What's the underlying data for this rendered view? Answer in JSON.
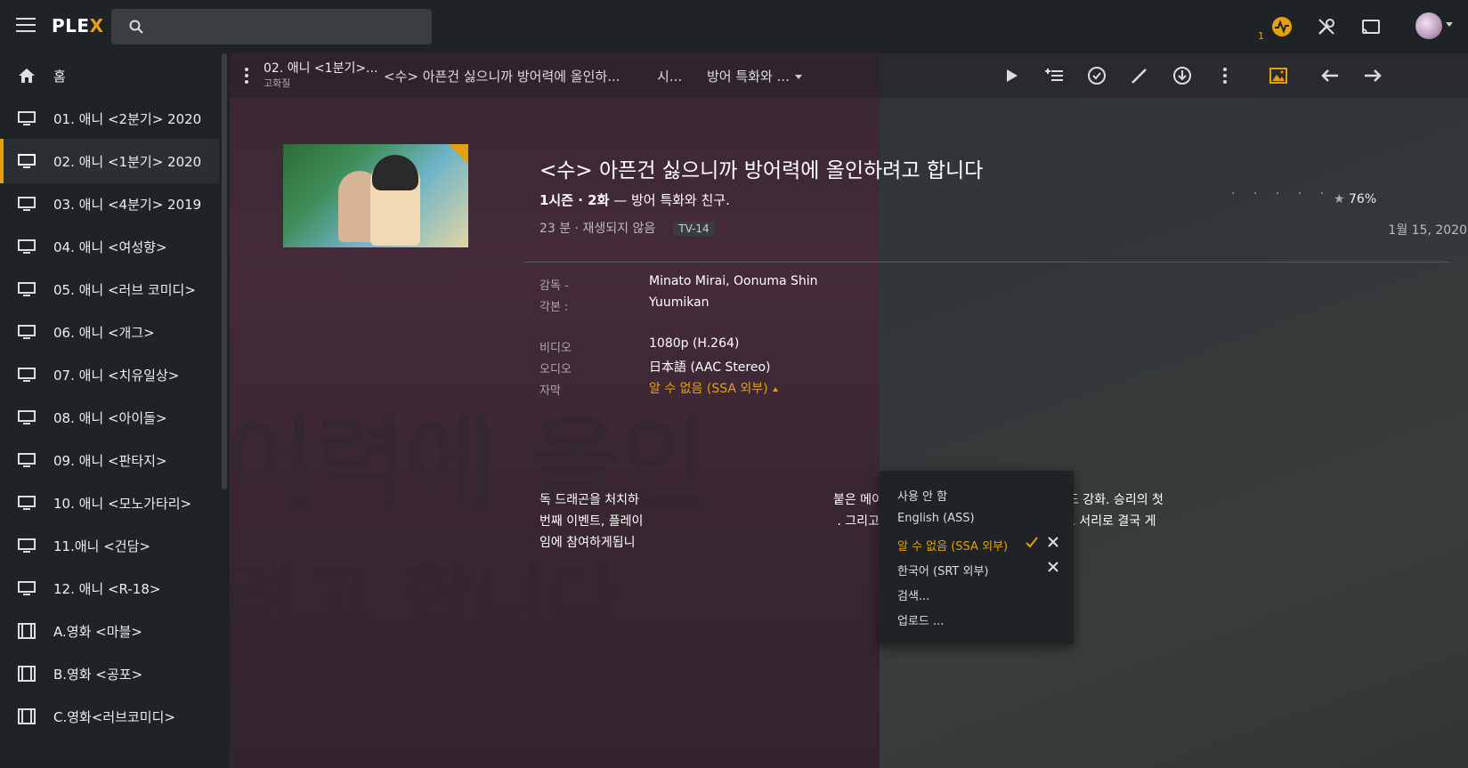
{
  "app": {
    "logo_text": "PLE",
    "logo_x": "X"
  },
  "topbar": {
    "activity_count": "1",
    "accent": "#e5a00d"
  },
  "sidebar": {
    "items": [
      {
        "label": "홈",
        "icon": "home-icon"
      },
      {
        "label": "01. 애니 <2분기> 2020",
        "icon": "tv-icon"
      },
      {
        "label": "02. 애니 <1분기> 2020",
        "icon": "tv-icon",
        "active": true
      },
      {
        "label": "03. 애니 <4분기> 2019",
        "icon": "tv-icon"
      },
      {
        "label": "04. 애니 <여성향>",
        "icon": "tv-icon"
      },
      {
        "label": "05. 애니 <러브 코미디>",
        "icon": "tv-icon"
      },
      {
        "label": "06. 애니 <개그>",
        "icon": "tv-icon"
      },
      {
        "label": "07. 애니 <치유일상>",
        "icon": "tv-icon"
      },
      {
        "label": "08. 애니 <아이돌>",
        "icon": "tv-icon"
      },
      {
        "label": "09. 애니 <판타지>",
        "icon": "tv-icon"
      },
      {
        "label": "10. 애니 <모노가타리>",
        "icon": "tv-icon"
      },
      {
        "label": "11.애니 <건담>",
        "icon": "tv-icon"
      },
      {
        "label": "12. 애니 <R-18>",
        "icon": "tv-icon"
      },
      {
        "label": "A.영화 <마블>",
        "icon": "film-icon"
      },
      {
        "label": "B.영화 <공포>",
        "icon": "film-icon"
      },
      {
        "label": "C.영화<러브코미디>",
        "icon": "film-icon"
      }
    ]
  },
  "actionbar": {
    "library_crumb": "02. 애니 <1분기>...",
    "library_sub": "고화질",
    "show_crumb": "<수> 아픈건 싫으니까 방어력에 올인하...",
    "season_crumb": "시...",
    "episode_crumb": "방어 특화와 ..."
  },
  "episode": {
    "title": "<수> 아픈건 싫으니까 방어력에 올인하려고 합니다",
    "season_episode": "1시즌 · 2화",
    "episode_title": "방어 특화와 친구.",
    "duration": "23 분",
    "play_state": "재생되지 않음",
    "content_rating": "TV-14",
    "rating_dots": "· · · · ·",
    "score": "76%",
    "air_date": "1월 15, 2020",
    "director_label": "감독 -",
    "director_value": "Minato Mirai, Oonuma Shin",
    "writer_label": "각본 :",
    "writer_value": "Yuumikan",
    "video_label": "비디오",
    "video_value": "1080p (H.264)",
    "audio_label": "오디오",
    "audio_value": "日本語 (AAC Stereo)",
    "subtitle_label": "자막",
    "subtitle_value": "알 수 없음 (SSA 외부)",
    "summary_line1_a": "독 드래곤을 처치하",
    "summary_line1_b": "붙은 메이플. 방어력이 더욱 높아져 있던 스킬도 강화. 승리의 첫",
    "summary_line2_a": "번째 이벤트, 플레이",
    "summary_line2_b": ". 그리고 단풍 나무를 초대 한 장본인의 리사도 서리로 결국 게",
    "summary_line3": "임에 참여하게됩니"
  },
  "subtitle_menu": {
    "items": [
      {
        "label": "사용 안 함"
      },
      {
        "label": "English (ASS)"
      },
      {
        "label": "알 수 없음 (SSA 외부)",
        "selected": true,
        "removable": true
      },
      {
        "label": "한국어 (SRT 외부)",
        "removable": true
      },
      {
        "label": "검색..."
      },
      {
        "label": "업로드 ..."
      }
    ]
  },
  "background_text": {
    "line1": "어력에 올인",
    "line2": "려고 합니다"
  }
}
